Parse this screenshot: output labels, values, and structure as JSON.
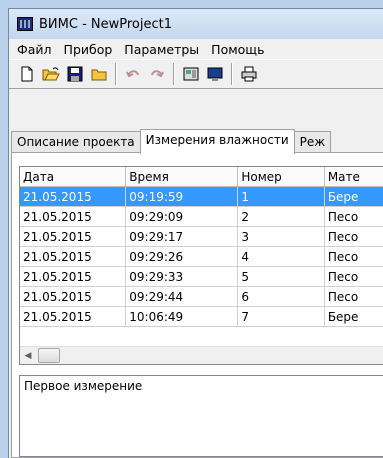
{
  "window": {
    "title": "ВИМС - NewProject1"
  },
  "menu": [
    "Файл",
    "Прибор",
    "Параметры",
    "Помощь"
  ],
  "toolbar": [
    "new-icon",
    "open-icon",
    "save-icon",
    "close-project-icon",
    "undo-icon",
    "redo-icon",
    "device-icon",
    "monitor-icon",
    "print-icon"
  ],
  "tabs": [
    "Описание проекта",
    "Измерения влажности",
    "Реж"
  ],
  "table": {
    "columns": [
      "Дата",
      "Время",
      "Номер",
      "Мате"
    ],
    "rows": [
      [
        "21.05.2015",
        "09:19:59",
        "1",
        "Бере"
      ],
      [
        "21.05.2015",
        "09:29:09",
        "2",
        "Песо"
      ],
      [
        "21.05.2015",
        "09:29:17",
        "3",
        "Песо"
      ],
      [
        "21.05.2015",
        "09:29:26",
        "4",
        "Песо"
      ],
      [
        "21.05.2015",
        "09:29:33",
        "5",
        "Песо"
      ],
      [
        "21.05.2015",
        "09:29:44",
        "6",
        "Песо"
      ],
      [
        "21.05.2015",
        "10:06:49",
        "7",
        "Бере"
      ]
    ],
    "selected_row": 0
  },
  "notes": {
    "text": "Первое измерение"
  }
}
